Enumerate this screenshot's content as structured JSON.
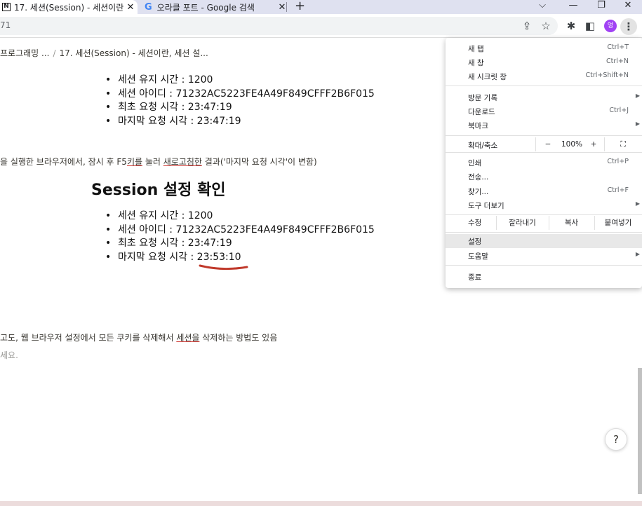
{
  "tabs": [
    {
      "title": "17. 세션(Session) - 세션이란, 세",
      "icon": "notion-icon",
      "active": true
    },
    {
      "title": "오라클 포트 - Google 검색",
      "icon": "google-icon",
      "active": false
    }
  ],
  "tab_icons": {
    "notion": "N",
    "google": "G",
    "close": "✕",
    "new_tab": "+"
  },
  "window_controls": {
    "dropdown": "⌵",
    "minimize": "—",
    "restore": "❐",
    "close": "✕"
  },
  "address": {
    "visible_text": "71"
  },
  "toolbar_icons": {
    "share": "⇪",
    "bookmark": "☆",
    "extensions": "✱",
    "sidepanel": "◧",
    "profile_initial": "엉",
    "menu": "⋮"
  },
  "breadcrumb": {
    "parent": "프로그래밍 ...",
    "separator": "/",
    "current": "17. 세션(Session) - 세션이란, 세션 설..."
  },
  "first_list": [
    "세션 유지 시간 : 1200",
    "세션 아이디 : 71232AC5223FE4A49F849CFFF2B6F015",
    "최초 요청 시각 : 23:47:19",
    "마지막 요청 시각 : 23:47:19"
  ],
  "caption": {
    "pre": "을 실행한 브라우저에서, 잠시 후 F5",
    "key_u": "키를",
    "mid": " 눌러 ",
    "refresh_u": "새로고침한",
    "post": " 결과('마지막 요청 시각'이 변함)"
  },
  "session_title": "Session 설정 확인",
  "second_list": [
    "세션 유지 시간 : 1200",
    "세션 아이디 : 71232AC5223FE4A49F849CFFF2B6F015",
    "최초 요청 시각 : 23:47:19",
    "마지막 요청 시각 : 23:53:10"
  ],
  "paragraph": {
    "pre": "고도, 웹 브라우저 설정에서 모든 쿠키를 삭제해서 ",
    "u": "세션을",
    "post": " 삭제하는 방법도 있음"
  },
  "hint": "세요.",
  "help_label": "?",
  "menu": {
    "new_tab": {
      "label": "새 탭",
      "shortcut": "Ctrl+T"
    },
    "new_window": {
      "label": "새 창",
      "shortcut": "Ctrl+N"
    },
    "incognito": {
      "label": "새 시크릿 창",
      "shortcut": "Ctrl+Shift+N"
    },
    "history": {
      "label": "방문 기록"
    },
    "downloads": {
      "label": "다운로드",
      "shortcut": "Ctrl+J"
    },
    "bookmarks": {
      "label": "북마크"
    },
    "zoom": {
      "label": "확대/축소",
      "minus": "−",
      "level": "100%",
      "plus": "+",
      "fullscreen": "⛶"
    },
    "print": {
      "label": "인쇄",
      "shortcut": "Ctrl+P"
    },
    "cast": {
      "label": "전송..."
    },
    "find": {
      "label": "찾기...",
      "shortcut": "Ctrl+F"
    },
    "more_tools": {
      "label": "도구 더보기"
    },
    "edit": {
      "label": "수정",
      "cut": "잘라내기",
      "copy": "복사",
      "paste": "붙여넣기"
    },
    "settings": {
      "label": "설정"
    },
    "help": {
      "label": "도움말"
    },
    "exit": {
      "label": "종료"
    },
    "submenu_arrow": "▶"
  },
  "colors": {
    "accent_underline": "#c0392b",
    "avatar": "#a142f4",
    "tab_strip": "#dfe1f0"
  }
}
